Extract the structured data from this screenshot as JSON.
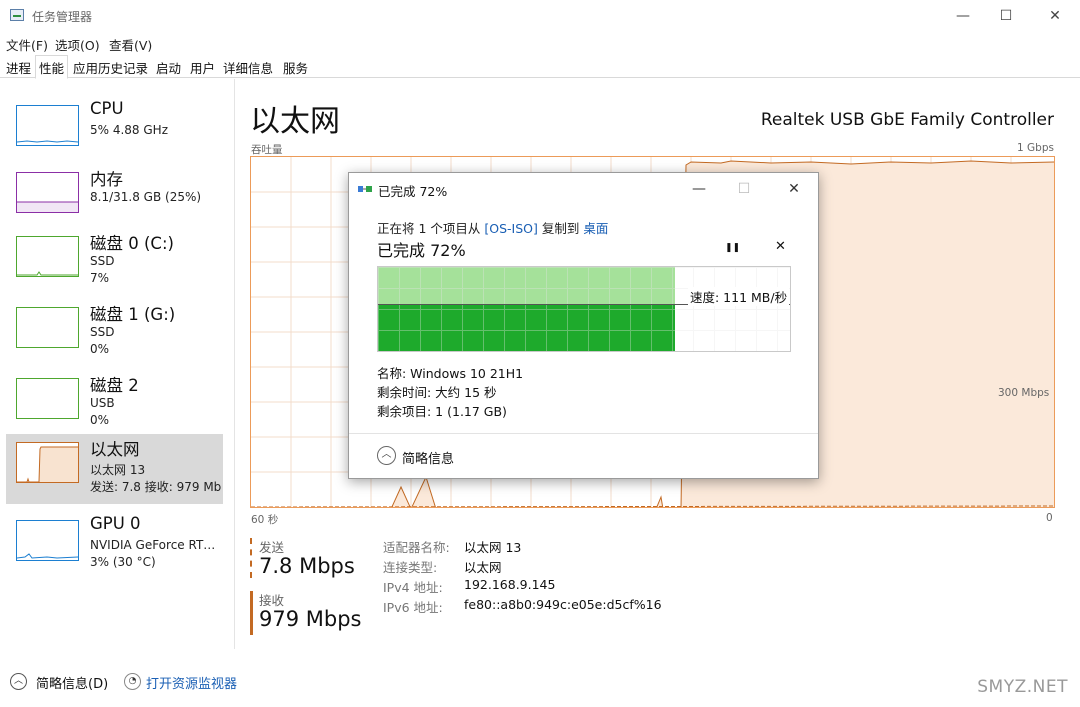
{
  "window": {
    "title": "任务管理器",
    "minimize": "—",
    "maximize": "☐",
    "close": "✕"
  },
  "menu": [
    "文件(F)",
    "选项(O)",
    "查看(V)"
  ],
  "tabs": [
    "进程",
    "性能",
    "应用历史记录",
    "启动",
    "用户",
    "详细信息",
    "服务"
  ],
  "active_tab": "性能",
  "sidebar": {
    "items": [
      {
        "title": "CPU",
        "sub1": "5% 4.88 GHz",
        "sub2": "",
        "sub3": "",
        "color": "#1c7fd1"
      },
      {
        "title": "内存",
        "sub1": "8.1/31.8 GB (25%)",
        "sub2": "",
        "sub3": "",
        "color": "#8b2fa6"
      },
      {
        "title": "磁盘 0 (C:)",
        "sub1": "SSD",
        "sub2": "7%",
        "sub3": "",
        "color": "#4ea72e"
      },
      {
        "title": "磁盘 1 (G:)",
        "sub1": "SSD",
        "sub2": "0%",
        "sub3": "",
        "color": "#4ea72e"
      },
      {
        "title": "磁盘 2",
        "sub1": "USB",
        "sub2": "0%",
        "sub3": "",
        "color": "#4ea72e"
      },
      {
        "title": "以太网",
        "sub1": "以太网 13",
        "sub2": "发送: 7.8 接收: 979 Mb",
        "sub3": "",
        "color": "#c36a23"
      },
      {
        "title": "GPU 0",
        "sub1": "NVIDIA GeForce RT…",
        "sub2": "3% (30 °C)",
        "sub3": "",
        "color": "#1c7fd1"
      }
    ]
  },
  "main": {
    "title": "以太网",
    "adapter": "Realtek USB GbE Family Controller",
    "graph_label": "吞吐量",
    "graph_max": "1 Gbps",
    "graph_mid": "300 Mbps",
    "time_left": "60 秒",
    "time_right": "0"
  },
  "stats": {
    "send_label": "发送",
    "send_value": "7.8 Mbps",
    "recv_label": "接收",
    "recv_value": "979 Mbps"
  },
  "properties": [
    {
      "key": "适配器名称:",
      "value": "以太网 13"
    },
    {
      "key": "连接类型:",
      "value": "以太网"
    },
    {
      "key": "IPv4 地址:",
      "value": "192.168.9.145"
    },
    {
      "key": "IPv6 地址:",
      "value": "fe80::a8b0:949c:e05e:d5cf%16"
    }
  ],
  "footer": {
    "less_details": "简略信息(D)",
    "open_monitor": "打开资源监视器"
  },
  "dialog": {
    "title": "已完成 72%",
    "line_prefix": "正在将 1 个项目从 ",
    "source": "[OS-ISO]",
    "line_mid": " 复制到 ",
    "dest": "桌面",
    "progress_title": "已完成 72%",
    "pause": "❚❚",
    "cancel": "✕",
    "progress_percent": 72,
    "speed": "速度: 111 MB/秒",
    "name": "名称: Windows 10 21H1",
    "remaining_time": "剩余时间: 大约 15 秒",
    "remaining_items": "剩余项目: 1 (1.17 GB)",
    "less_info": "简略信息",
    "minimize": "—",
    "maximize": "☐",
    "close": "✕"
  },
  "watermark": "SMYZ.NET"
}
